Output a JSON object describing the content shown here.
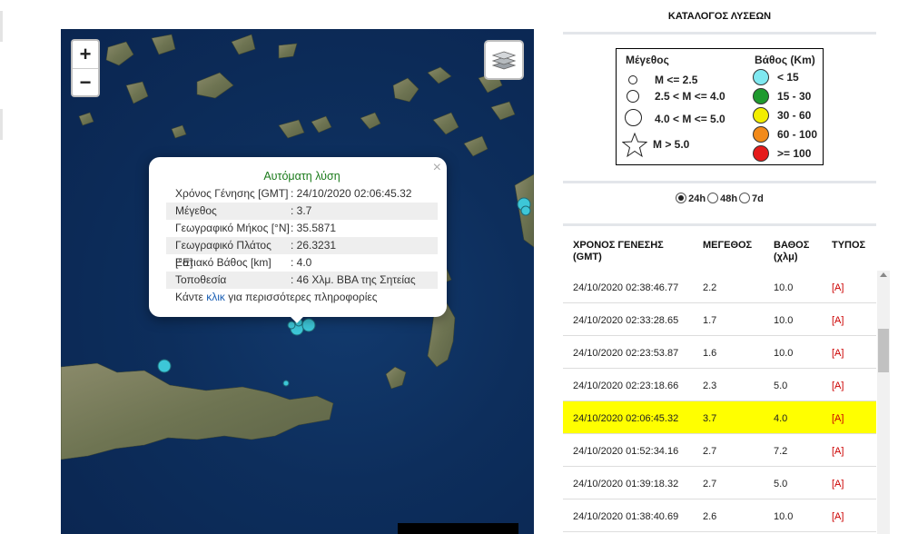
{
  "map": {
    "zoom_in": "+",
    "zoom_out": "−",
    "layers_icon": "layers-icon",
    "quake_color": "#3dc7d8"
  },
  "popup": {
    "close": "×",
    "title": "Αυτόματη λύση",
    "rows": [
      {
        "label": "Χρόνος Γένησης [GMT]",
        "value": ": 24/10/2020 02:06:45.32"
      },
      {
        "label": "Μέγεθος",
        "value": ": 3.7"
      },
      {
        "label": "Γεωγραφικό Μήκος [°N]",
        "value": ": 35.5871"
      },
      {
        "label": "Γεωγραφικό Πλάτος [°E]",
        "value": ": 26.3231"
      },
      {
        "label": "Εστιακό Βάθος [km]",
        "value": ": 4.0"
      },
      {
        "label": "Τοποθεσία",
        "value": ": 46 Χλμ. ΒΒΑ της Σητείας"
      }
    ],
    "footer_pre": "Κάντε ",
    "footer_link": "κλικ",
    "footer_post": " για περισσότερες πληροφορίες"
  },
  "catalog": {
    "title": "ΚΑΤΑΛΟΓΟΣ ΛΥΣΕΩΝ"
  },
  "legend": {
    "magnitude_heading": "Μέγεθος",
    "magnitude_items": [
      "M <= 2.5",
      "2.5 < M <= 4.0",
      "4.0 < M <= 5.0",
      "M > 5.0"
    ],
    "depth_heading": "Βάθος (Km)",
    "depth_items": [
      {
        "label": "< 15",
        "color": "#7fe8f0"
      },
      {
        "label": "15 - 30",
        "color": "#1f9a2e"
      },
      {
        "label": "30 - 60",
        "color": "#f2ee00"
      },
      {
        "label": "60 - 100",
        "color": "#f28a1a"
      },
      {
        "label": ">= 100",
        "color": "#e51a1a"
      }
    ]
  },
  "periods": {
    "options": [
      "24h",
      "48h",
      "7d"
    ],
    "selected": "24h"
  },
  "table": {
    "headers": {
      "time": "ΧΡΟΝΟΣ ΓΕΝΕΣΗΣ (GMT)",
      "magnitude": "ΜΕΓΕΘΟΣ",
      "depth": "ΒΑΘΟΣ (χλμ)",
      "type": "ΤΥΠΟΣ"
    },
    "rows": [
      {
        "time": "24/10/2020 02:38:46.77",
        "mag": "2.2",
        "depth": "10.0",
        "type": "[A]"
      },
      {
        "time": "24/10/2020 02:33:28.65",
        "mag": "1.7",
        "depth": "10.0",
        "type": "[A]"
      },
      {
        "time": "24/10/2020 02:23:53.87",
        "mag": "1.6",
        "depth": "10.0",
        "type": "[A]"
      },
      {
        "time": "24/10/2020 02:23:18.66",
        "mag": "2.3",
        "depth": "5.0",
        "type": "[A]"
      },
      {
        "time": "24/10/2020 02:06:45.32",
        "mag": "3.7",
        "depth": "4.0",
        "type": "[A]"
      },
      {
        "time": "24/10/2020 01:52:34.16",
        "mag": "2.7",
        "depth": "7.2",
        "type": "[A]"
      },
      {
        "time": "24/10/2020 01:39:18.32",
        "mag": "2.7",
        "depth": "5.0",
        "type": "[A]"
      },
      {
        "time": "24/10/2020 01:38:40.69",
        "mag": "2.6",
        "depth": "10.0",
        "type": "[A]"
      }
    ],
    "highlighted_time": "24/10/2020 02:06:45.32",
    "highlight_color": "#ffff00"
  }
}
